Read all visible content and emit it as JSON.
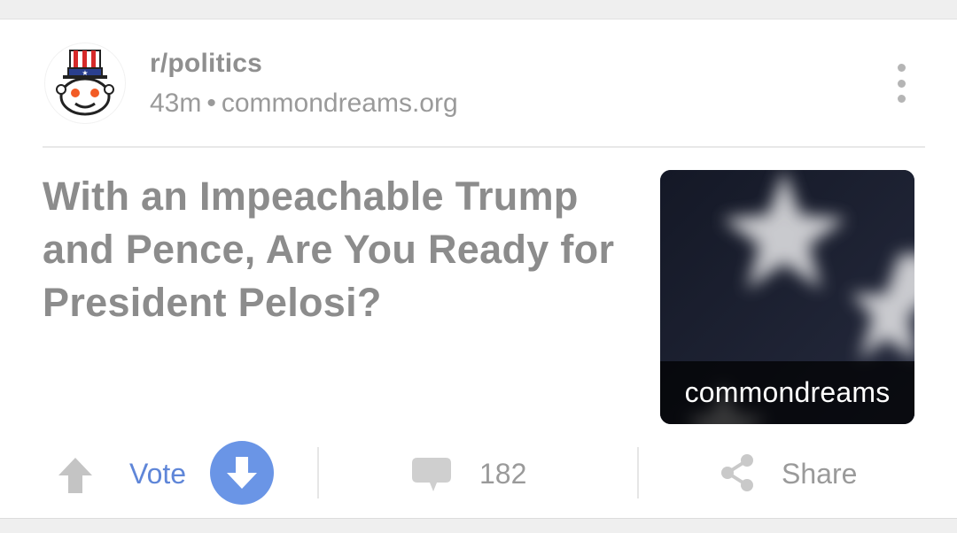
{
  "post": {
    "subreddit": "r/politics",
    "age": "43m",
    "separator": "•",
    "domain": "commondreams.org",
    "title": "With an Impeachable Trump and Pence, Are You Ready for President Pelosi?",
    "thumbnail_caption": "commondreams"
  },
  "actions": {
    "vote_label": "Vote",
    "comment_count": "182",
    "share_label": "Share"
  },
  "icons": {
    "avatar": "subreddit-avatar-uncle-sam-snoo",
    "overflow": "more-vertical-icon",
    "upvote": "arrow-up-icon",
    "downvote": "arrow-down-icon",
    "comments": "comment-bubble-icon",
    "share": "share-icon"
  },
  "colors": {
    "accent_blue": "#6a95e6",
    "vote_text": "#5f86d8",
    "muted_text": "#9a9a9a",
    "title_text": "#8c8c8c"
  }
}
